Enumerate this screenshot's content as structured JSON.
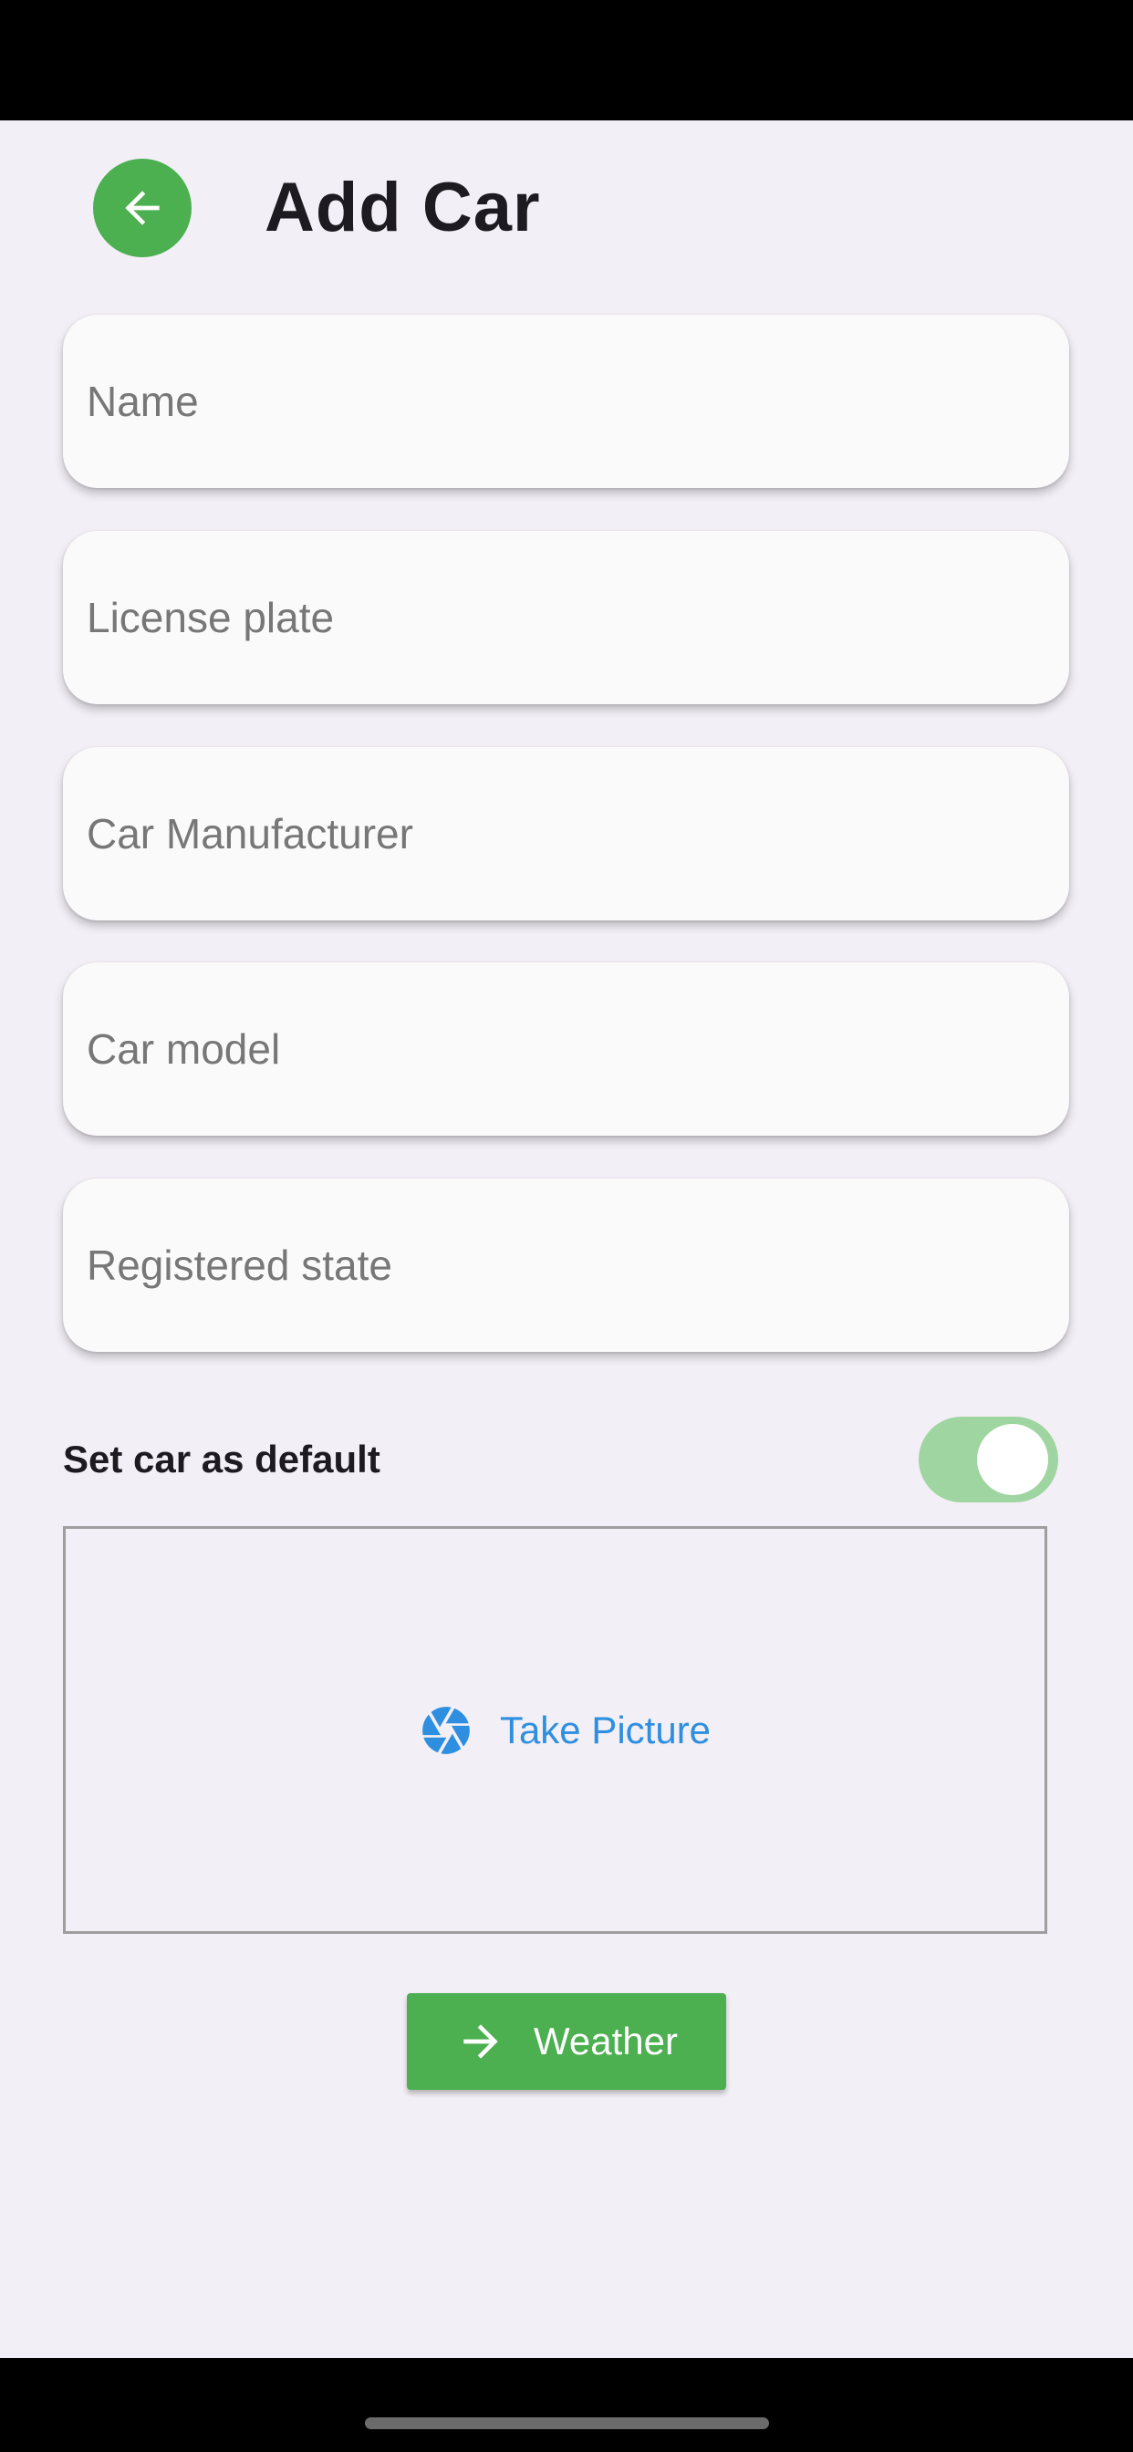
{
  "header": {
    "title": "Add Car",
    "back_icon": "arrow-left-icon"
  },
  "form": {
    "fields": [
      {
        "id": "name",
        "placeholder": "Name",
        "value": ""
      },
      {
        "id": "license_plate",
        "placeholder": "License plate",
        "value": ""
      },
      {
        "id": "manufacturer",
        "placeholder": "Car Manufacturer",
        "value": ""
      },
      {
        "id": "model",
        "placeholder": "Car model",
        "value": ""
      },
      {
        "id": "registered_state",
        "placeholder": "Registered state",
        "value": ""
      }
    ]
  },
  "default_toggle": {
    "label": "Set car as default",
    "checked": true
  },
  "picture": {
    "label": "Take Picture",
    "icon": "camera-shutter-icon"
  },
  "weather_button": {
    "label": "Weather",
    "icon": "arrow-right-icon"
  },
  "colors": {
    "accent_green": "#4caf50",
    "toggle_track": "#9fd5a0",
    "link_blue": "#2e8fe0",
    "background": "#f3eff6"
  }
}
